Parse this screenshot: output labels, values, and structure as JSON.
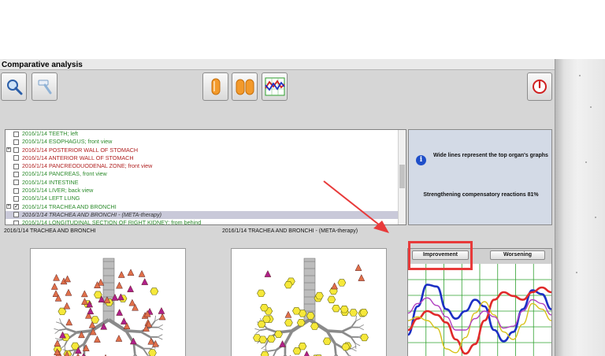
{
  "window": {
    "title": "Comparative analysis"
  },
  "toolbar": {
    "buttons": [
      {
        "name": "search-button",
        "icon": "magnifier-icon"
      },
      {
        "name": "hammer-button",
        "icon": "hammer-icon"
      },
      {
        "name": "single-organ-button",
        "icon": "orange-cylinder-icon"
      },
      {
        "name": "compare-organs-button",
        "icon": "double-cylinder-icon"
      },
      {
        "name": "graph-button",
        "icon": "chart-lines-icon"
      },
      {
        "name": "power-button",
        "icon": "power-icon"
      }
    ]
  },
  "organ_list": {
    "items": [
      {
        "label": "2016/1/14  TEETH; left",
        "color": "#2a8a2a",
        "checked": false,
        "expander": false
      },
      {
        "label": "2016/1/14  ESOPHAGUS; front view",
        "color": "#2a8a2a",
        "checked": false,
        "expander": false
      },
      {
        "label": "2016/1/14  POSTERIOR WALL OF STOMACH",
        "color": "#b02020",
        "checked": false,
        "expander": true
      },
      {
        "label": "2016/1/14  ANTERIOR  WALL  OF  STOMACH",
        "color": "#b02020",
        "checked": false,
        "expander": false
      },
      {
        "label": "2016/1/14  PANCREODUODENAL ZONE; front view",
        "color": "#b02020",
        "checked": false,
        "expander": false
      },
      {
        "label": "2016/1/14  PANCREAS,  front  view",
        "color": "#2a8a2a",
        "checked": false,
        "expander": false
      },
      {
        "label": "2016/1/14  INTESTINE",
        "color": "#2a8a2a",
        "checked": false,
        "expander": false
      },
      {
        "label": "2016/1/14  LIVER; back view",
        "color": "#2a8a2a",
        "checked": false,
        "expander": false
      },
      {
        "label": "2016/1/14  LEFT  LUNG",
        "color": "#2a8a2a",
        "checked": false,
        "expander": false
      },
      {
        "label": "2016/1/14  TRACHEA  AND  BRONCHI",
        "color": "#2a8a2a",
        "checked": true,
        "expander": true
      },
      {
        "label": "2016/1/14  TRACHEA  AND  BRONCHI - (META-therapy)",
        "color": "#333333",
        "checked": false,
        "expander": false,
        "selected": true
      },
      {
        "label": "2016/1/14  LONGITUDINAL  SECTION  OF  RIGHT  KIDNEY; from behind",
        "color": "#2a8a2a",
        "checked": false,
        "expander": false
      }
    ]
  },
  "info": {
    "icon": "info-icon",
    "note": "Wide lines represent the top organ's graphs",
    "status": "Strengthening compensatory reactions 81%"
  },
  "captions": {
    "left": "2016/1/14  TRACHEA  AND  BRONCHI",
    "right": "2016/1/14  TRACHEA  AND  BRONCHI - (META-therapy)"
  },
  "graph": {
    "improvement_label": "Improvement",
    "worsening_label": "Worsening",
    "grid_color": "#2ea02e",
    "series": [
      {
        "color": "#1c2fc4",
        "width": 2.6,
        "values": [
          0.25,
          0.55,
          0.78,
          0.76,
          0.52,
          0.42,
          0.5,
          0.62,
          0.55,
          0.3,
          0.18,
          0.28,
          0.52,
          0.72,
          0.68,
          0.52
        ]
      },
      {
        "color": "#e02a2a",
        "width": 2.6,
        "values": [
          0.3,
          0.42,
          0.5,
          0.46,
          0.38,
          0.2,
          0.05,
          0.15,
          0.4,
          0.62,
          0.7,
          0.66,
          0.62,
          0.7,
          0.75,
          0.7
        ]
      },
      {
        "color": "#d8c21a",
        "width": 1.4,
        "values": [
          0.4,
          0.44,
          0.4,
          0.32,
          0.1,
          0.06,
          0.22,
          0.48,
          0.6,
          0.46,
          0.28,
          0.2,
          0.36,
          0.58,
          0.52,
          0.4
        ]
      },
      {
        "color": "#b040c0",
        "width": 1.4,
        "values": [
          0.48,
          0.58,
          0.64,
          0.56,
          0.44,
          0.3,
          0.3,
          0.42,
          0.5,
          0.44,
          0.32,
          0.34,
          0.5,
          0.62,
          0.58,
          0.46
        ]
      }
    ]
  },
  "colors": {
    "marker_yellow": "#f6e83a",
    "marker_orange": "#e0704a",
    "marker_magenta": "#b0208a"
  }
}
